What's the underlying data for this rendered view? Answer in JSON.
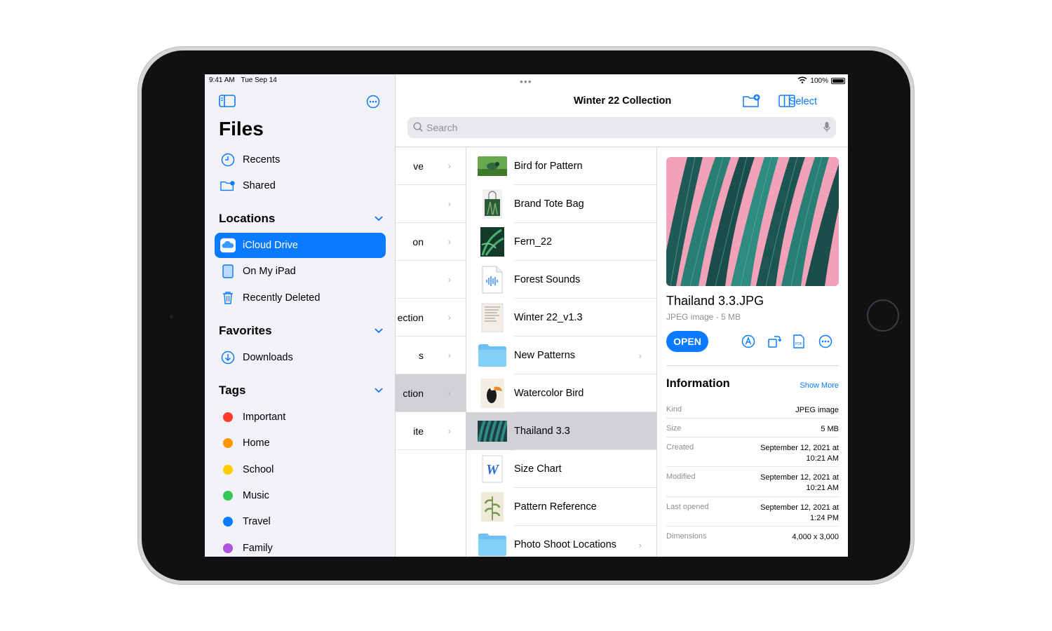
{
  "status": {
    "time": "9:41 AM",
    "date": "Tue Sep 14",
    "battery": "100%"
  },
  "sidebar": {
    "title": "Files",
    "top_items": [
      {
        "label": "Recents",
        "icon": "clock-icon"
      },
      {
        "label": "Shared",
        "icon": "shared-folder-icon"
      }
    ],
    "locations": {
      "title": "Locations",
      "items": [
        {
          "label": "iCloud Drive",
          "icon": "icloud-icon",
          "selected": true
        },
        {
          "label": "On My iPad",
          "icon": "ipad-icon"
        },
        {
          "label": "Recently Deleted",
          "icon": "trash-icon"
        }
      ]
    },
    "favorites": {
      "title": "Favorites",
      "items": [
        {
          "label": "Downloads",
          "icon": "download-icon"
        }
      ]
    },
    "tags": {
      "title": "Tags",
      "items": [
        {
          "label": "Important",
          "color": "#ff3b30"
        },
        {
          "label": "Home",
          "color": "#ff9500"
        },
        {
          "label": "School",
          "color": "#ffcc00"
        },
        {
          "label": "Music",
          "color": "#34c759"
        },
        {
          "label": "Travel",
          "color": "#0a7aff"
        },
        {
          "label": "Family",
          "color": "#af52de"
        }
      ]
    }
  },
  "header": {
    "title": "Winter 22 Collection",
    "select_label": "Select",
    "search_placeholder": "Search"
  },
  "column1": {
    "items": [
      {
        "label": "ve"
      },
      {
        "label": ""
      },
      {
        "label": "on"
      },
      {
        "label": ""
      },
      {
        "label": "ection"
      },
      {
        "label": "s"
      },
      {
        "label": "ction",
        "selected": true
      },
      {
        "label": "ite"
      }
    ]
  },
  "column2": {
    "items": [
      {
        "label": "Bird for Pattern",
        "thumb": "bird-image"
      },
      {
        "label": "Brand Tote Bag",
        "thumb": "tote-bag-image"
      },
      {
        "label": "Fern_22",
        "thumb": "fern-image"
      },
      {
        "label": "Forest Sounds",
        "thumb": "audio-file-icon"
      },
      {
        "label": "Winter 22_v1.3",
        "thumb": "catalog-document-image"
      },
      {
        "label": "New Patterns",
        "thumb": "folder-icon",
        "folder": true
      },
      {
        "label": "Watercolor Bird",
        "thumb": "toucan-image"
      },
      {
        "label": "Thailand 3.3",
        "thumb": "leaves-image",
        "selected": true
      },
      {
        "label": "Size Chart",
        "thumb": "word-document-icon"
      },
      {
        "label": "Pattern Reference",
        "thumb": "botanical-image"
      },
      {
        "label": "Photo Shoot Locations",
        "thumb": "folder-icon",
        "folder": true
      }
    ]
  },
  "preview": {
    "filename": "Thailand 3.3.JPG",
    "meta": "JPEG image - 5 MB",
    "open_label": "OPEN",
    "info_title": "Information",
    "show_more": "Show More",
    "info": [
      {
        "key": "Kind",
        "value": "JPEG image"
      },
      {
        "key": "Size",
        "value": "5 MB"
      },
      {
        "key": "Created",
        "value": "September 12, 2021 at 10:21 AM"
      },
      {
        "key": "Modified",
        "value": "September 12, 2021 at 10:21 AM"
      },
      {
        "key": "Last opened",
        "value": "September 12, 2021 at 1:24 PM"
      },
      {
        "key": "Dimensions",
        "value": "4,000 x 3,000"
      }
    ]
  },
  "colors": {
    "accent": "#0a7aff",
    "sidebar_bg": "#f2f2f7",
    "selected_row": "#d1d1d6",
    "leaf_pink": "#f2a2b8",
    "leaf_teal": "#1f6f66"
  }
}
